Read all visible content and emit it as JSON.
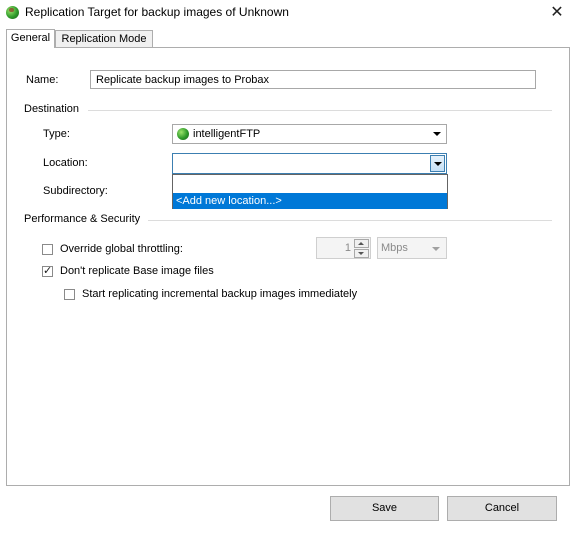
{
  "window": {
    "title": "Replication Target for backup images of Unknown",
    "close_glyph": "✕"
  },
  "tabs": [
    {
      "label": "General",
      "active": true
    },
    {
      "label": "Replication Mode",
      "active": false
    }
  ],
  "general": {
    "name_label": "Name:",
    "name_value": "Replicate backup images to Probax",
    "destination_heading": "Destination",
    "type_label": "Type:",
    "type_value": "intelligentFTP",
    "location_label": "Location:",
    "location_value": "",
    "subdirectory_label": "Subdirectory:",
    "location_options": [
      "",
      "<Add new location...>"
    ],
    "performance_heading": "Performance & Security",
    "override_label": "Override global throttling:",
    "override_checked": false,
    "throttle_value": "1",
    "throttle_unit": "Mbps",
    "dont_replicate_label": "Don't replicate Base image files",
    "dont_replicate_checked": true,
    "start_incremental_label": "Start replicating incremental backup images immediately",
    "start_incremental_checked": false
  },
  "buttons": {
    "save": "Save",
    "cancel": "Cancel"
  },
  "colors": {
    "selection": "#0078d7",
    "focus_border": "#3c7fb1",
    "button_bg": "#e1e1e1"
  },
  "icons": {
    "app": "globe-icon",
    "type": "globe-icon"
  }
}
